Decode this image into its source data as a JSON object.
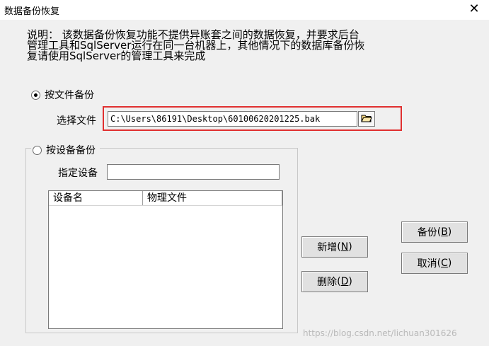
{
  "window": {
    "title": "数据备份恢复",
    "close_glyph": "✕"
  },
  "description": "说明： 该数据备份恢复功能不提供异账套之间的数据恢复，并要求后台\n管理工具和SqlServer运行在同一台机器上，其他情况下的数据库备份恢\n复请使用SqlServer的管理工具来完成",
  "file_backup": {
    "radio_label": "按文件备份",
    "selected": true,
    "file_label": "选择文件",
    "file_value": "C:\\Users\\86191\\Desktop\\60100620201225.bak",
    "browse_icon": "folder-open-icon"
  },
  "device_backup": {
    "radio_label": "按设备备份",
    "selected": false,
    "device_label": "指定设备",
    "device_value": "",
    "columns": [
      "设备名",
      "物理文件"
    ]
  },
  "buttons": {
    "add": {
      "text": "新增",
      "key": "N"
    },
    "delete": {
      "text": "删除",
      "key": "D"
    },
    "backup": {
      "text": "备份",
      "key": "B"
    },
    "cancel": {
      "text": "取消",
      "key": "C"
    }
  },
  "watermark": "https://blog.csdn.net/lichuan301626",
  "colors": {
    "highlight_border": "#e03030",
    "window_bg": "#f0f0f0"
  }
}
